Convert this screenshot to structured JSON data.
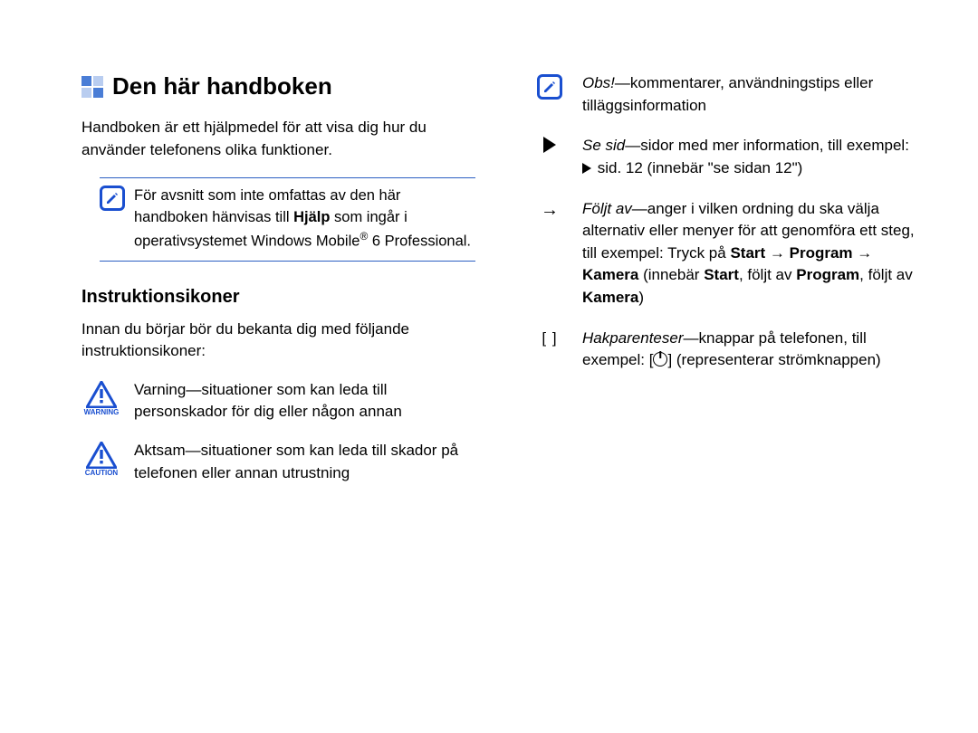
{
  "heading": "Den här handboken",
  "intro": "Handboken är ett hjälpmedel för att visa dig hur du använder telefonens olika funktioner.",
  "note": {
    "pre": "För avsnitt som inte omfattas av den här handboken hänvisas till ",
    "bold1": "Hjälp",
    "mid": " som ingår i operativsystemet Windows Mobile",
    "reg": "®",
    "post": " 6 Professional."
  },
  "subheading": "Instruktionsikoner",
  "sub_intro": "Innan du börjar bör du bekanta dig med följande instruktionsikoner:",
  "warning": {
    "label": "WARNING",
    "text": "Varning—situationer som kan leda till personskador för dig eller någon annan"
  },
  "caution": {
    "label": "CAUTION",
    "text": "Aktsam—situationer som kan leda till skador på telefonen eller annan utrustning"
  },
  "obs": {
    "lead": "Obs!",
    "rest": "—kommentarer, användningstips eller tilläggsinformation"
  },
  "sesid": {
    "lead": "Se sid",
    "rest1": "—sidor med mer information, till exempel: ",
    "example": " sid. 12 (innebär \"se sidan 12\")"
  },
  "folj": {
    "symbol": "→",
    "lead": "Följt av",
    "rest1": "—anger i vilken ordning du ska välja alternativ eller menyer för att genomföra ett steg, till exempel: Tryck på ",
    "b1": "Start",
    "arrow": " → ",
    "b2": "Program",
    "b3": "Kamera",
    "rest2": " (innebär ",
    "b4": "Start",
    "rest3": ", följt av ",
    "b5": "Program",
    "rest4": ", följt av ",
    "b6": "Kamera",
    "rest5": ")"
  },
  "hak": {
    "symbol": "[    ]",
    "lead": "Hakparenteser",
    "rest1": "—knappar på telefonen, till exempel: [",
    "rest2": "] (representerar strömknappen)"
  }
}
